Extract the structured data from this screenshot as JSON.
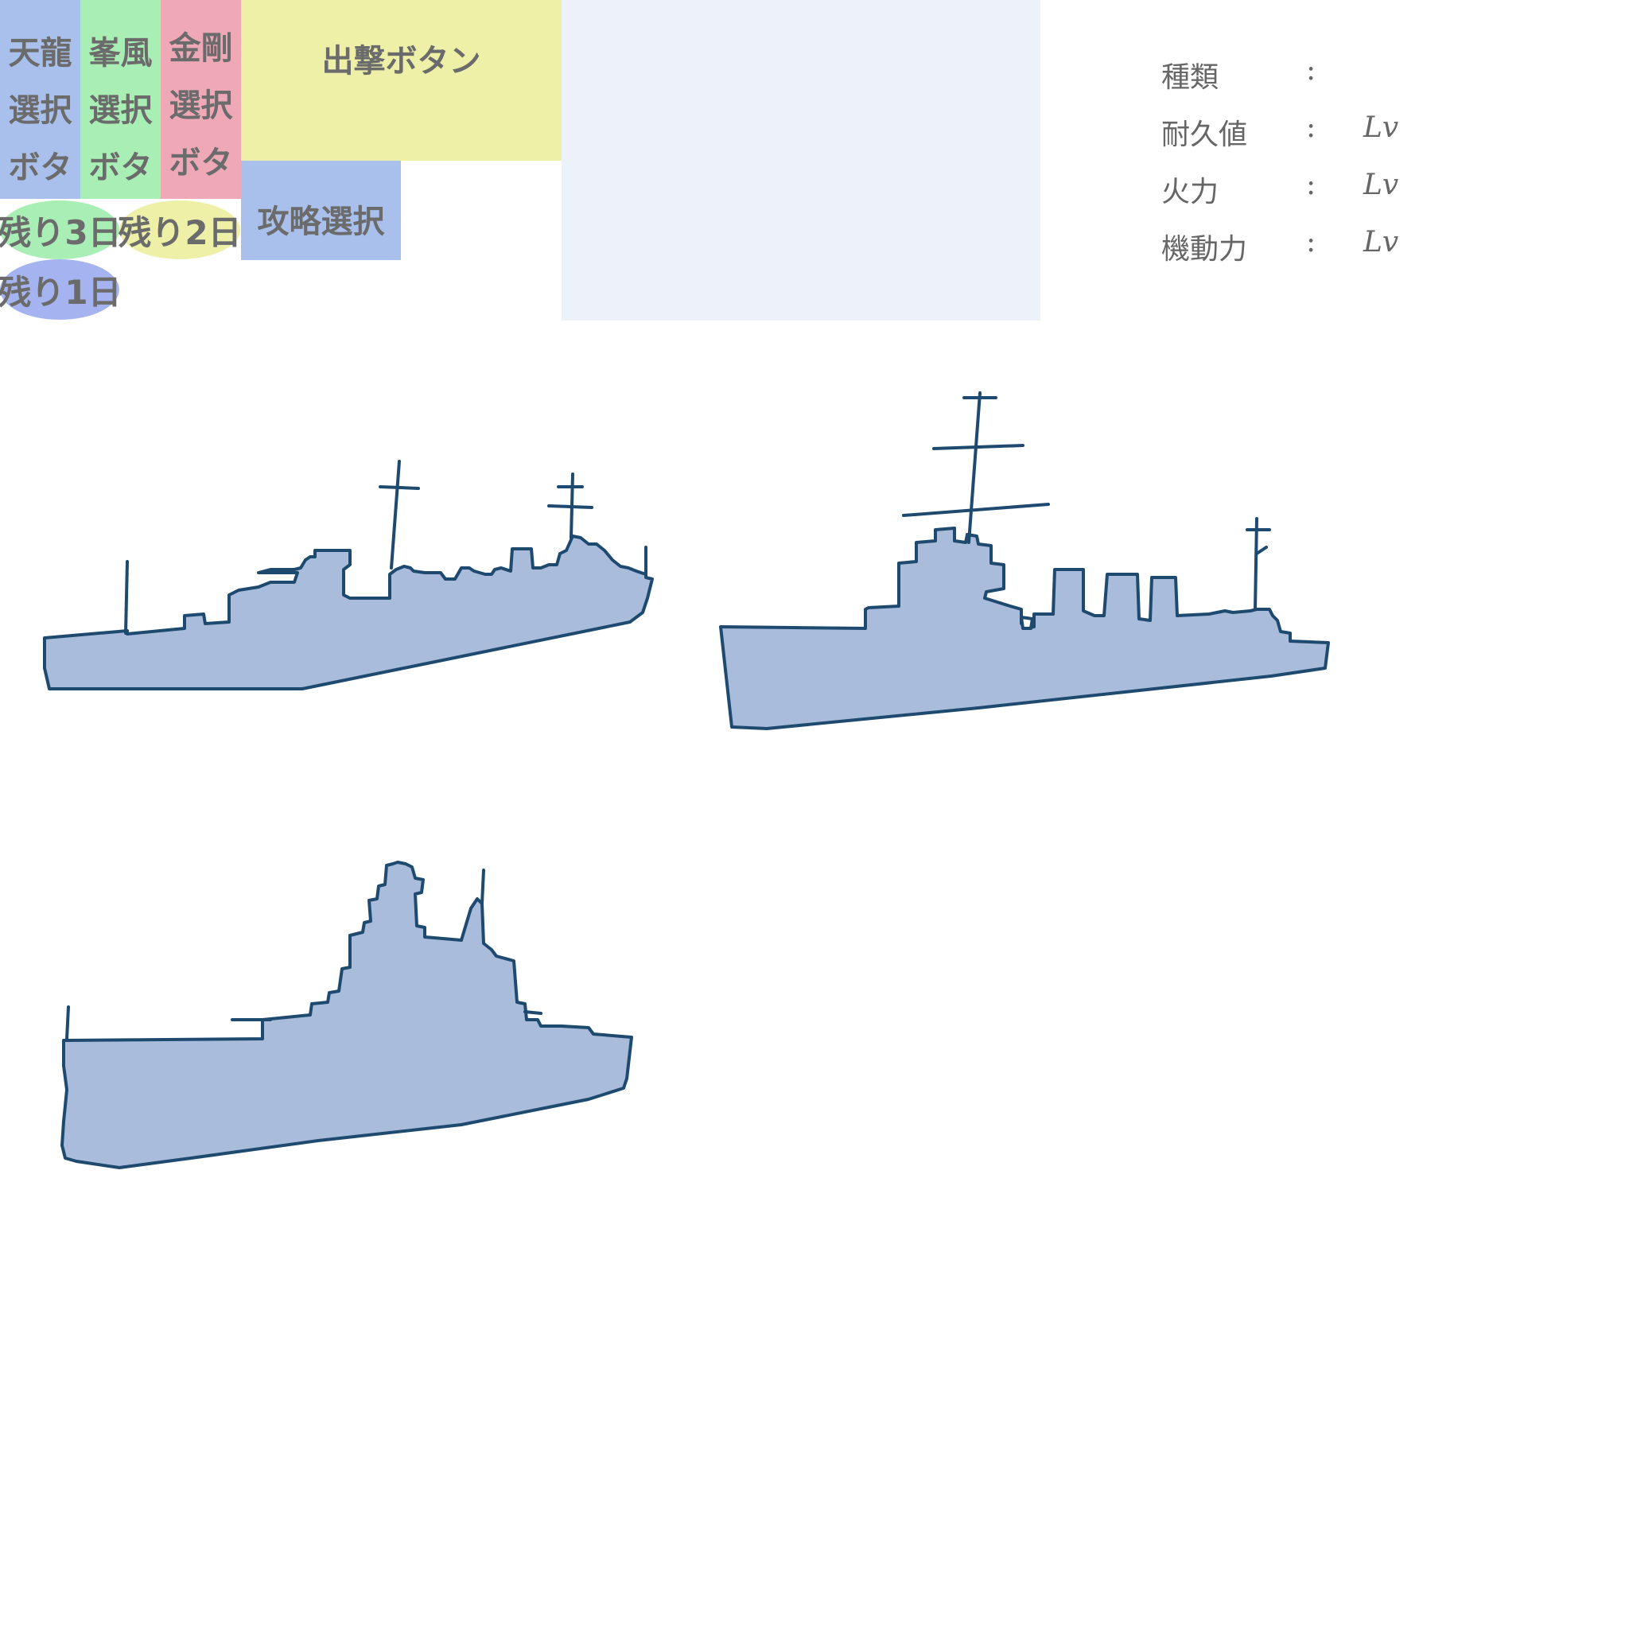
{
  "ship_select": [
    {
      "name": "天龍",
      "select": "選択",
      "button": "ボタ",
      "color": "#a9c0ec"
    },
    {
      "name": "峯風",
      "select": "選択",
      "button": "ボタ",
      "color": "#a8eeb5"
    },
    {
      "name": "金剛",
      "select": "選択",
      "button": "ボタ",
      "color": "#eea8b6"
    }
  ],
  "sortie_button": {
    "label": "出撃ボタン",
    "color": "#eef0a8"
  },
  "strategy_button": {
    "label": "攻略選択",
    "color": "#a9c0ec"
  },
  "days_remaining": [
    {
      "label": "残り3日",
      "color": "#a8eeb5"
    },
    {
      "label": "残り2日",
      "color": "#eef0a8"
    },
    {
      "label": "残り1日",
      "color": "#a5b4f0"
    }
  ],
  "preview_panel": {
    "color": "#edf1f9"
  },
  "stats": [
    {
      "label": "種類",
      "colon": ":",
      "value": ""
    },
    {
      "label": "耐久値",
      "colon": ":",
      "value": "Lv"
    },
    {
      "label": "火力",
      "colon": ":",
      "value": "Lv"
    },
    {
      "label": "機動力",
      "colon": ":",
      "value": "Lv"
    }
  ],
  "ships": [
    {
      "icon": "light-cruiser-silhouette"
    },
    {
      "icon": "destroyer-silhouette"
    },
    {
      "icon": "battleship-silhouette"
    }
  ],
  "colors": {
    "text_gray": "#6b6b6b",
    "ship_fill": "#a9bcdc",
    "ship_stroke": "#1f4a70"
  }
}
